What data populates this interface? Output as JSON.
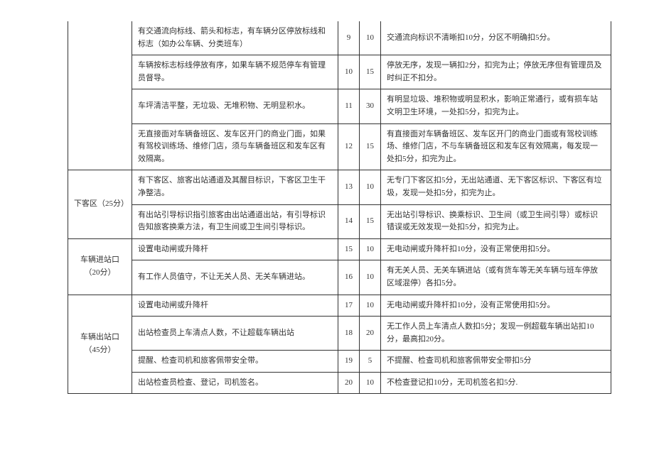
{
  "rows": [
    {
      "category": "",
      "rowspan": 4,
      "requirement": "有交通流向标线、箭头和标志，有车辆分区停放标线和标志（如办公车辆、分类班车）",
      "index": "9",
      "points": "10",
      "deduction": "交通流向标识不清晰扣10分，分区不明确扣5分。"
    },
    {
      "requirement": "车辆按标志标线停放有序，如果车辆不规范停车有管理员督导。",
      "index": "10",
      "points": "15",
      "deduction": "停放无序，发现一辆扣2分，扣完为止；停放无序但有管理员及时纠正不扣分。"
    },
    {
      "requirement": "车坪清洁平整，无垃圾、无堆积物、无明显积水。",
      "index": "11",
      "points": "30",
      "deduction": "有明显垃圾、堆积物或明显积水，影响正常通行，或有损车站文明卫生环境，一处扣5分，扣完为止。"
    },
    {
      "requirement": "无直接面对车辆备班区、发车区开门的商业门面，如果有驾校训练场、维修门店，须与车辆备班区和发车区有效隔离。",
      "index": "12",
      "points": "15",
      "deduction": "有直接面对车辆备班区、发车区开门的商业门面或有驾校训练场、维修门店，不与车辆备班区和发车区有效隔离，每发现一处扣5分，扣完为止。"
    },
    {
      "category": "下客区（25分）",
      "rowspan": 2,
      "requirement": "有下客区、旅客出站通道及其醒目标识，下客区卫生干净整洁。",
      "index": "13",
      "points": "10",
      "deduction": "无专门下客区扣5分，无出站通道、无下客区标识、下客区有垃圾，发现一处扣5分，扣完为止。"
    },
    {
      "requirement": "有出站引导标识指引旅客由出站通道出站，有引导标识告知旅客换乘方法，有卫生间或卫生间引导标识。",
      "index": "14",
      "points": "15",
      "deduction": "无出站引导标识、换乘标识、卫生间（或卫生间引导）或标识错误或无效发现一处扣5分，扣完为止。"
    },
    {
      "category": "车辆进站口（20分）",
      "rowspan": 2,
      "requirement": "设置电动闸或升降杆",
      "index": "15",
      "points": "10",
      "deduction": "无电动闸或升降杆扣10分，没有正常使用扣5分。"
    },
    {
      "requirement": "有工作人员值守，不让无关人员、无关车辆进站。",
      "index": "16",
      "points": "10",
      "deduction": "有无关人员、无关车辆进站（或有货车等无关车辆与班车停放区域混停）各扣5分。"
    },
    {
      "category": "车辆出站口（45分）",
      "rowspan": 4,
      "requirement": "设置电动闸或升降杆",
      "index": "17",
      "points": "10",
      "deduction": "无电动闸或升降杆扣10分，没有正常使用扣5分。"
    },
    {
      "requirement": "出站检查员上车清点人数，不让超载车辆出站",
      "index": "18",
      "points": "20",
      "deduction": "无工作人员上车清点人数扣5分；发现一例超载车辆出站扣10分，最高扣20分。"
    },
    {
      "requirement": "提醒、检查司机和旅客佩带安全带。",
      "index": "19",
      "points": "5",
      "deduction": "不提醒、检查司机和旅客佩带安全带扣5分"
    },
    {
      "requirement": "出站检查员检查、登记，司机签名。",
      "index": "20",
      "points": "10",
      "deduction": "不检查登记扣10分，无司机签名扣5分."
    }
  ]
}
